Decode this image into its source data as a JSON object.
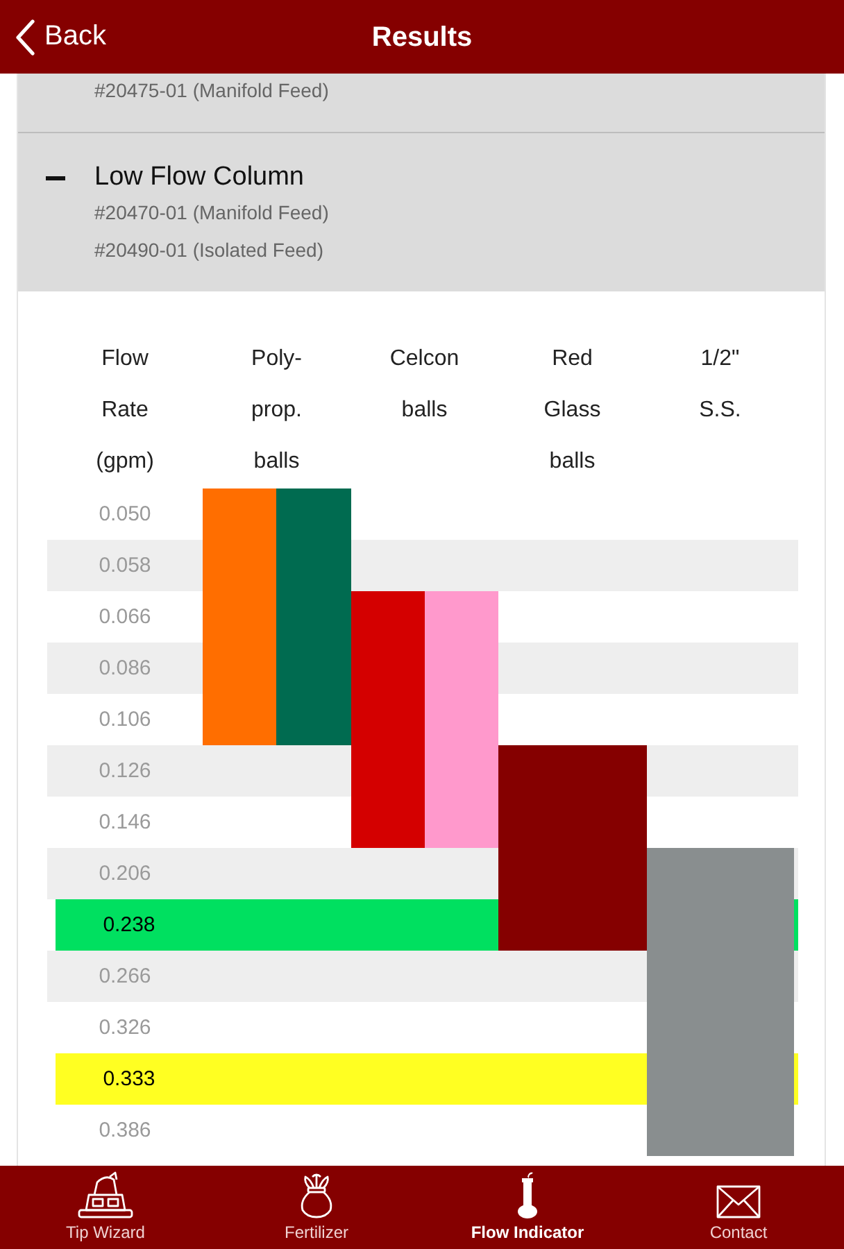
{
  "header": {
    "back": "Back",
    "title": "Results"
  },
  "accordion": {
    "partial_section": {
      "lines": [
        "#20475-01 (Manifold Feed)"
      ]
    },
    "open_section": {
      "title": "Low Flow Column",
      "expanded": true,
      "lines": [
        "#20470-01 (Manifold Feed)",
        "#20490-01 (Isolated Feed)"
      ]
    }
  },
  "table": {
    "columns": [
      {
        "label": "Flow\nRate\n(gpm)"
      },
      {
        "label": "Poly-\nprop.\nballs",
        "fills": [
          {
            "color": "#ff6e00"
          },
          {
            "color": "#006b50"
          }
        ]
      },
      {
        "label": "Celcon\nballs",
        "fills": [
          {
            "color": "#d40000"
          },
          {
            "color": "#ff99cc"
          }
        ]
      },
      {
        "label": "Red\nGlass\nballs",
        "fills": [
          {
            "color": "#850000"
          }
        ]
      },
      {
        "label": "1/2\"\nS.S.",
        "fills": [
          {
            "color": "#898e8f"
          }
        ]
      }
    ],
    "rows": [
      {
        "rate": "0.050",
        "cells": [
          true,
          false,
          false,
          false
        ]
      },
      {
        "rate": "0.058",
        "cells": [
          true,
          false,
          false,
          false
        ]
      },
      {
        "rate": "0.066",
        "cells": [
          true,
          true,
          false,
          false
        ]
      },
      {
        "rate": "0.086",
        "cells": [
          true,
          true,
          false,
          false
        ]
      },
      {
        "rate": "0.106",
        "cells": [
          true,
          true,
          false,
          false
        ]
      },
      {
        "rate": "0.126",
        "cells": [
          false,
          true,
          true,
          false
        ]
      },
      {
        "rate": "0.146",
        "cells": [
          false,
          true,
          true,
          false
        ]
      },
      {
        "rate": "0.206",
        "cells": [
          false,
          false,
          true,
          true
        ]
      },
      {
        "rate": "0.238",
        "cells": [
          false,
          false,
          true,
          true
        ],
        "color": "#00e060"
      },
      {
        "rate": "0.266",
        "cells": [
          false,
          false,
          false,
          true
        ]
      },
      {
        "rate": "0.326",
        "cells": [
          false,
          false,
          false,
          true
        ]
      },
      {
        "rate": "0.333",
        "cells": [
          false,
          false,
          false,
          true
        ],
        "color": "#ffff22"
      },
      {
        "rate": "0.386",
        "cells": [
          false,
          false,
          false,
          true
        ]
      }
    ]
  },
  "tab_bar": {
    "tabs": [
      {
        "label": "Tip Wizard",
        "selected": false,
        "kind": "machine"
      },
      {
        "label": "Fertilizer",
        "selected": false,
        "kind": "sack"
      },
      {
        "label": "Flow Indicator",
        "selected": true,
        "kind": "meter"
      },
      {
        "label": "Contact",
        "selected": false,
        "kind": "envelope"
      }
    ]
  }
}
